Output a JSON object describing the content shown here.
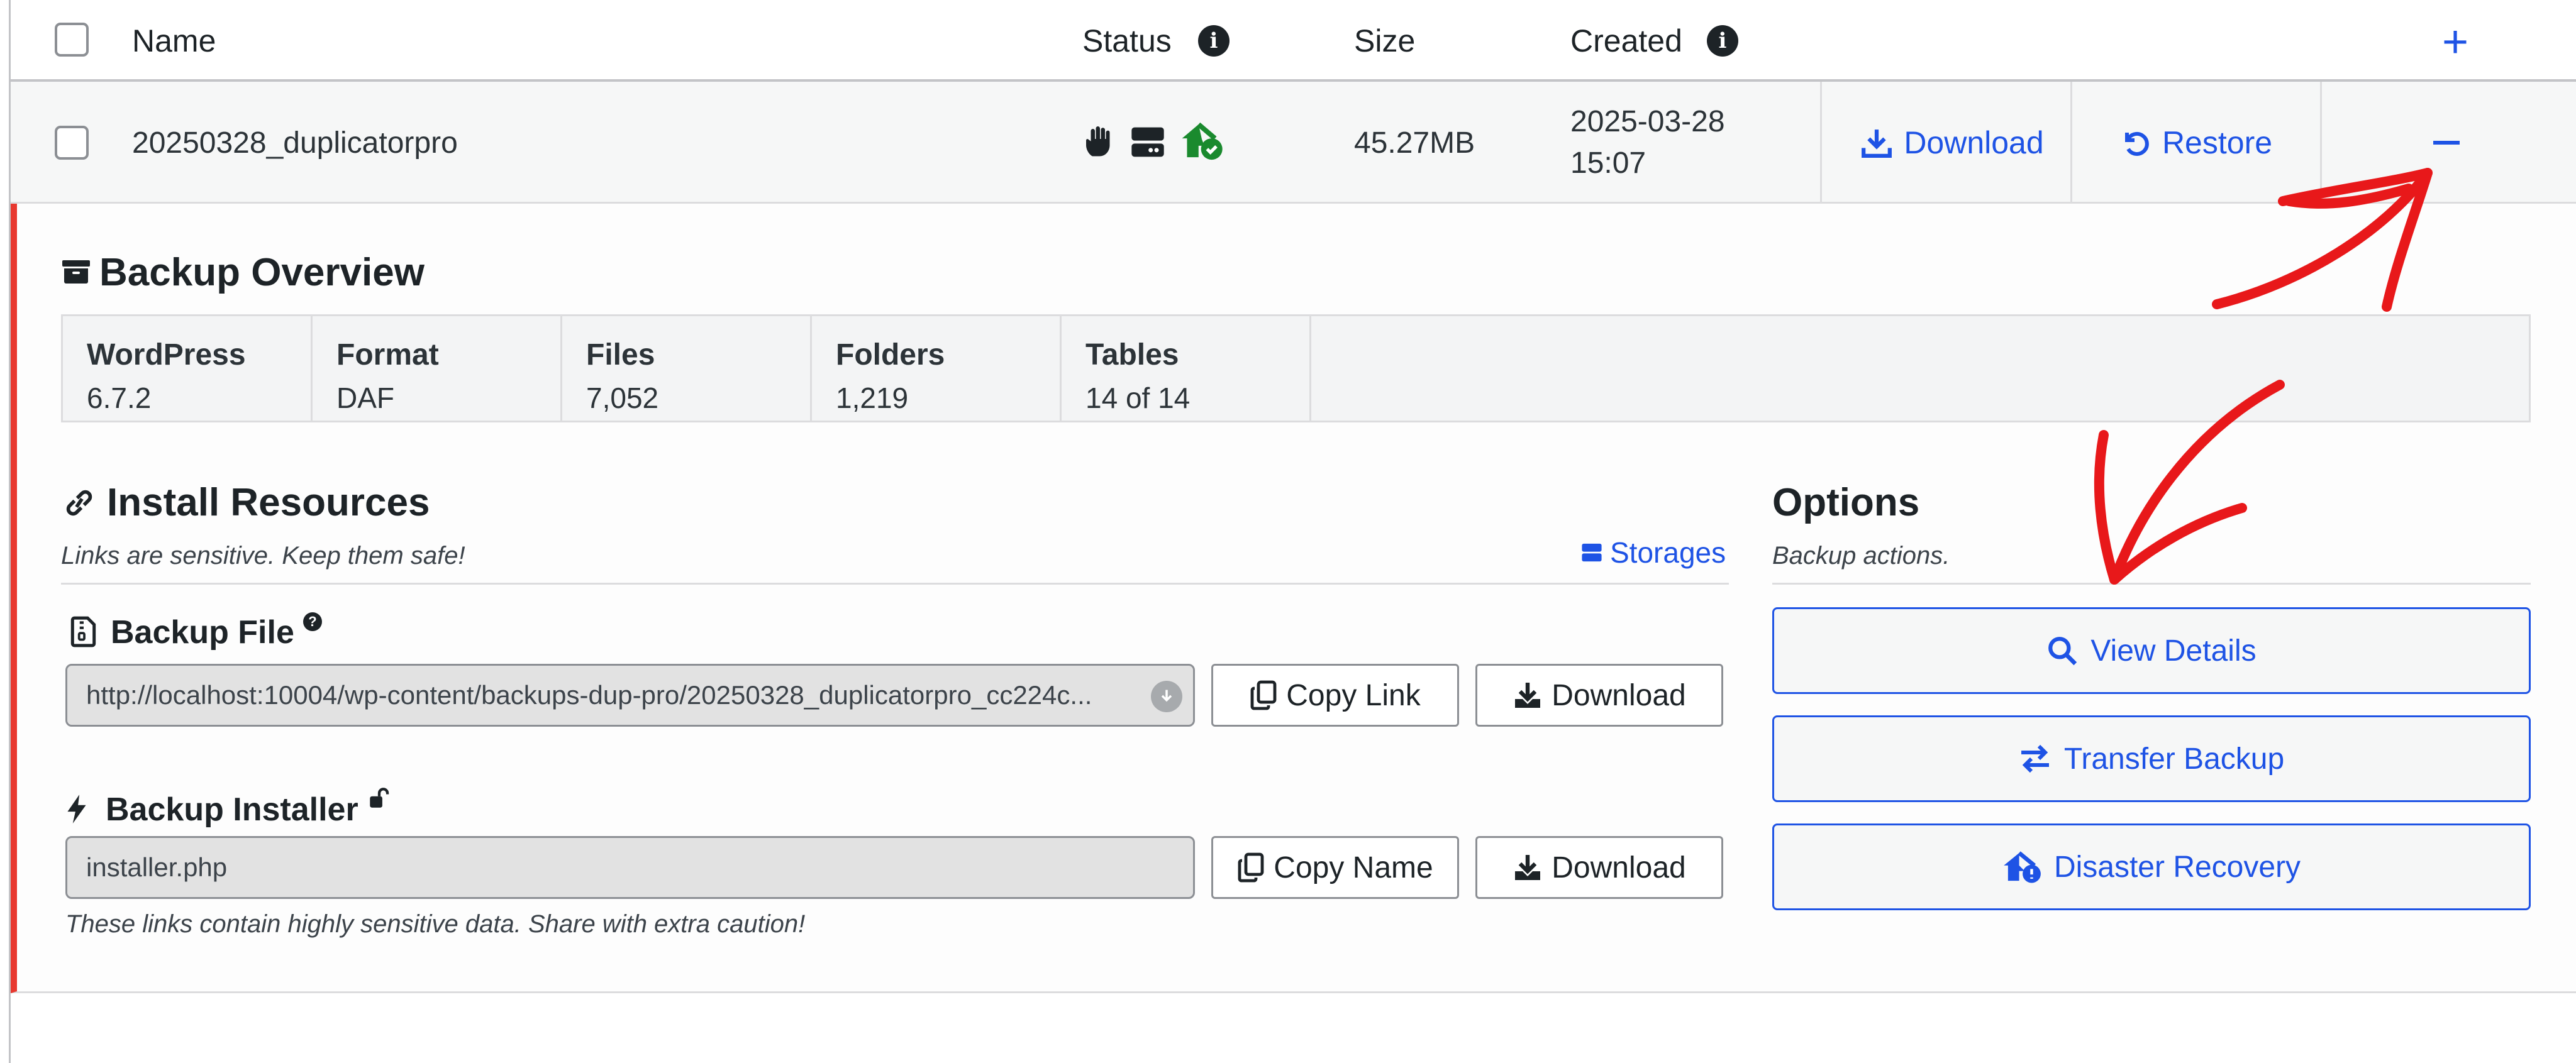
{
  "header": {
    "name_col": "Name",
    "status_col": "Status",
    "size_col": "Size",
    "created_col": "Created",
    "expand_all_symbol": "+"
  },
  "package_row": {
    "name": "20250328_duplicatorpro",
    "status_icons": [
      "hand-icon",
      "server-icon",
      "house-shield-icon"
    ],
    "size": "45.27MB",
    "created_date": "2025-03-28",
    "created_time": "15:07",
    "download_label": "Download",
    "restore_label": "Restore"
  },
  "overview": {
    "title": "Backup Overview",
    "cells": [
      {
        "label": "WordPress",
        "value": "6.7.2"
      },
      {
        "label": "Format",
        "value": "DAF"
      },
      {
        "label": "Files",
        "value": "7,052"
      },
      {
        "label": "Folders",
        "value": "1,219"
      },
      {
        "label": "Tables",
        "value": "14 of 14"
      }
    ]
  },
  "install_resources": {
    "title": "Install Resources",
    "subtitle": "Links are sensitive. Keep them safe!",
    "storages_link": "Storages",
    "backup_file": {
      "title": "Backup File",
      "url": "http://localhost:10004/wp-content/backups-dup-pro/20250328_duplicatorpro_cc224c...",
      "copy_label": "Copy Link",
      "download_label": "Download"
    },
    "backup_installer": {
      "title": "Backup Installer",
      "value": "installer.php",
      "copy_label": "Copy Name",
      "download_label": "Download"
    },
    "warning": "These links contain highly sensitive data. Share with extra caution!"
  },
  "options": {
    "title": "Options",
    "subtitle": "Backup actions.",
    "view_details": "View Details",
    "transfer_backup": "Transfer Backup",
    "disaster_recovery": "Disaster Recovery"
  },
  "colors": {
    "accent": "#1e53e5",
    "status_green": "#1a8a2e",
    "panel_border": "#e8382f",
    "annotation": "#e8181a"
  }
}
